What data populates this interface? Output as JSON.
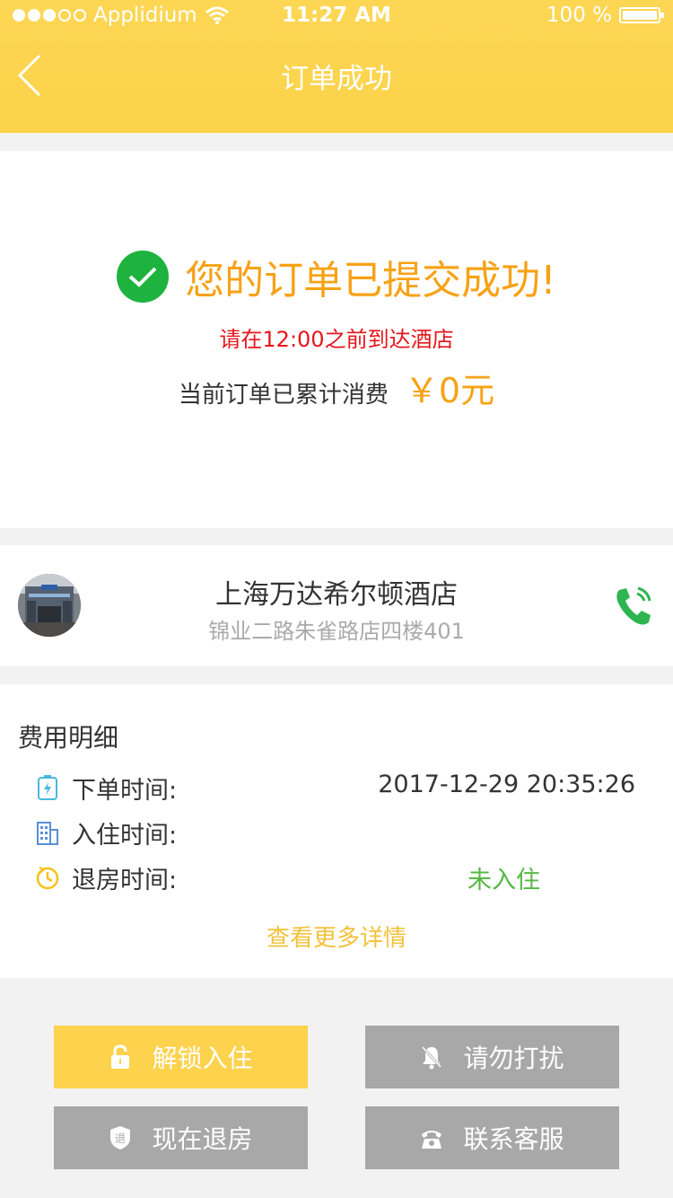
{
  "status_bar": {
    "carrier": "Applidium",
    "time": "11:27 AM",
    "battery": "100 %"
  },
  "header": {
    "title": "订单成功"
  },
  "success": {
    "message": "您的订单已提交成功!",
    "notice": "请在12:00之前到达酒店",
    "total_label": "当前订单已累计消费",
    "total_amount": "￥0元"
  },
  "hotel": {
    "name": "上海万达希尔顿酒店",
    "address": "锦业二路朱雀路店四楼401"
  },
  "fees": {
    "title": "费用明细",
    "rows": [
      {
        "label": "下单时间:",
        "value": "2017-12-29 20:35:26"
      },
      {
        "label": "入住时间:",
        "value": ""
      },
      {
        "label": "退房时间:",
        "value": "未入住"
      }
    ],
    "more": "查看更多详情"
  },
  "actions": {
    "unlock": "解锁入住",
    "dnd": "请勿打扰",
    "checkout": "现在退房",
    "contact": "联系客服"
  },
  "colors": {
    "brand": "#fdd24c",
    "accent_text": "#f7a215",
    "success": "#1db33e",
    "alert": "#e5161b",
    "disabled": "#a8a8a8"
  },
  "icons": [
    "back-icon",
    "check-icon",
    "phone-icon",
    "battery-charge-icon",
    "building-icon",
    "clock-icon",
    "lock-icon",
    "bell-off-icon",
    "checkout-badge-icon",
    "telephone-icon"
  ]
}
